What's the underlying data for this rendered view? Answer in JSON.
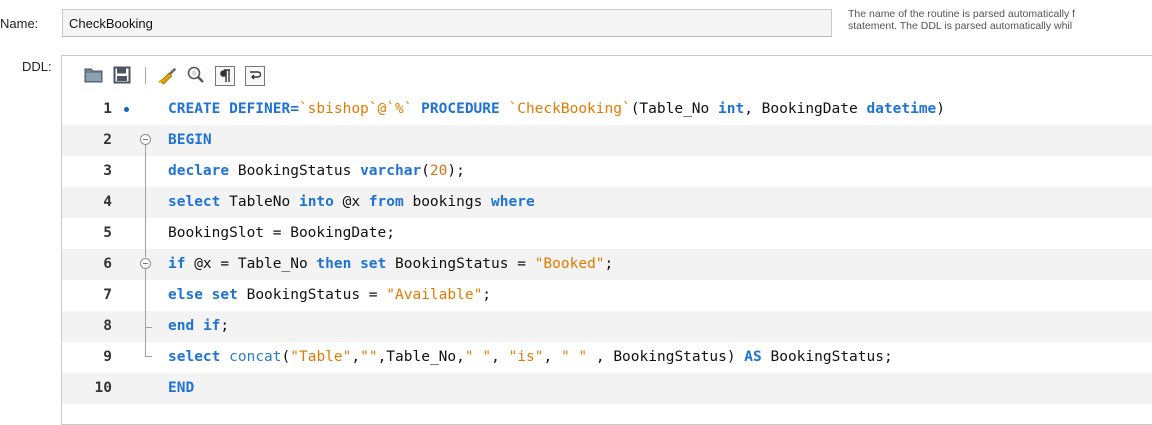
{
  "name_field": {
    "label": "Name:",
    "value": "CheckBooking",
    "hint_line1": "The name of the routine is parsed automatically f",
    "hint_line2": "statement. The DDL is parsed automatically whil"
  },
  "ddl_label": "DDL:",
  "toolbar": {
    "buttons": [
      "open-folder-icon",
      "save-icon",
      "beautify-icon",
      "find-icon",
      "paragraph-icon",
      "wrap-icon"
    ]
  },
  "code_lines": [
    {
      "n": "1",
      "tokens": [
        {
          "t": "CREATE DEFINER=",
          "c": "kw"
        },
        {
          "t": "`sbishop`@`%`",
          "c": "str"
        },
        {
          "t": " PROCEDURE ",
          "c": "kw"
        },
        {
          "t": "`CheckBooking`",
          "c": "str"
        },
        {
          "t": "(Table_No ",
          "c": "plain"
        },
        {
          "t": "int",
          "c": "kw"
        },
        {
          "t": ", BookingDate ",
          "c": "plain"
        },
        {
          "t": "datetime",
          "c": "kw"
        },
        {
          "t": ")",
          "c": "plain"
        }
      ]
    },
    {
      "n": "2",
      "tokens": [
        {
          "t": "BEGIN",
          "c": "kw"
        }
      ]
    },
    {
      "n": "3",
      "tokens": [
        {
          "t": "declare",
          "c": "kw"
        },
        {
          "t": " BookingStatus ",
          "c": "plain"
        },
        {
          "t": "varchar",
          "c": "kw"
        },
        {
          "t": "(",
          "c": "plain"
        },
        {
          "t": "20",
          "c": "num"
        },
        {
          "t": ");",
          "c": "plain"
        }
      ]
    },
    {
      "n": "4",
      "tokens": [
        {
          "t": "select",
          "c": "kw"
        },
        {
          "t": " TableNo ",
          "c": "plain"
        },
        {
          "t": "into",
          "c": "kw"
        },
        {
          "t": " @x ",
          "c": "plain"
        },
        {
          "t": "from",
          "c": "kw"
        },
        {
          "t": " bookings ",
          "c": "plain"
        },
        {
          "t": "where",
          "c": "kw"
        }
      ]
    },
    {
      "n": "5",
      "tokens": [
        {
          "t": "BookingSlot = BookingDate;",
          "c": "plain"
        }
      ]
    },
    {
      "n": "6",
      "tokens": [
        {
          "t": "if",
          "c": "kw"
        },
        {
          "t": " @x = Table_No ",
          "c": "plain"
        },
        {
          "t": "then",
          "c": "kw"
        },
        {
          "t": " ",
          "c": "plain"
        },
        {
          "t": "set",
          "c": "kw"
        },
        {
          "t": " BookingStatus = ",
          "c": "plain"
        },
        {
          "t": "\"Booked\"",
          "c": "str"
        },
        {
          "t": ";",
          "c": "plain"
        }
      ]
    },
    {
      "n": "7",
      "tokens": [
        {
          "t": "else",
          "c": "kw"
        },
        {
          "t": " ",
          "c": "plain"
        },
        {
          "t": "set",
          "c": "kw"
        },
        {
          "t": " BookingStatus = ",
          "c": "plain"
        },
        {
          "t": "\"Available\"",
          "c": "str"
        },
        {
          "t": ";",
          "c": "plain"
        }
      ]
    },
    {
      "n": "8",
      "tokens": [
        {
          "t": "end",
          "c": "kw"
        },
        {
          "t": " ",
          "c": "plain"
        },
        {
          "t": "if",
          "c": "kw"
        },
        {
          "t": ";",
          "c": "plain"
        }
      ]
    },
    {
      "n": "9",
      "tokens": [
        {
          "t": "select",
          "c": "kw"
        },
        {
          "t": " ",
          "c": "plain"
        },
        {
          "t": "concat",
          "c": "fn"
        },
        {
          "t": "(",
          "c": "plain"
        },
        {
          "t": "\"Table\"",
          "c": "str"
        },
        {
          "t": ",",
          "c": "plain"
        },
        {
          "t": "\"\"",
          "c": "str"
        },
        {
          "t": ",Table_No,",
          "c": "plain"
        },
        {
          "t": "\" \"",
          "c": "str"
        },
        {
          "t": ", ",
          "c": "plain"
        },
        {
          "t": "\"is\"",
          "c": "str"
        },
        {
          "t": ", ",
          "c": "plain"
        },
        {
          "t": "\" \"",
          "c": "str"
        },
        {
          "t": " , BookingStatus) ",
          "c": "plain"
        },
        {
          "t": "AS",
          "c": "kw"
        },
        {
          "t": " BookingStatus;",
          "c": "plain"
        }
      ]
    },
    {
      "n": "10",
      "tokens": [
        {
          "t": "END",
          "c": "kw"
        }
      ]
    }
  ],
  "colors": {
    "keyword": "#1e73d4",
    "string": "#e27b00",
    "number": "#d6751a",
    "breakpoint": "#1565c0",
    "alt_row": "#f3f3f3"
  }
}
